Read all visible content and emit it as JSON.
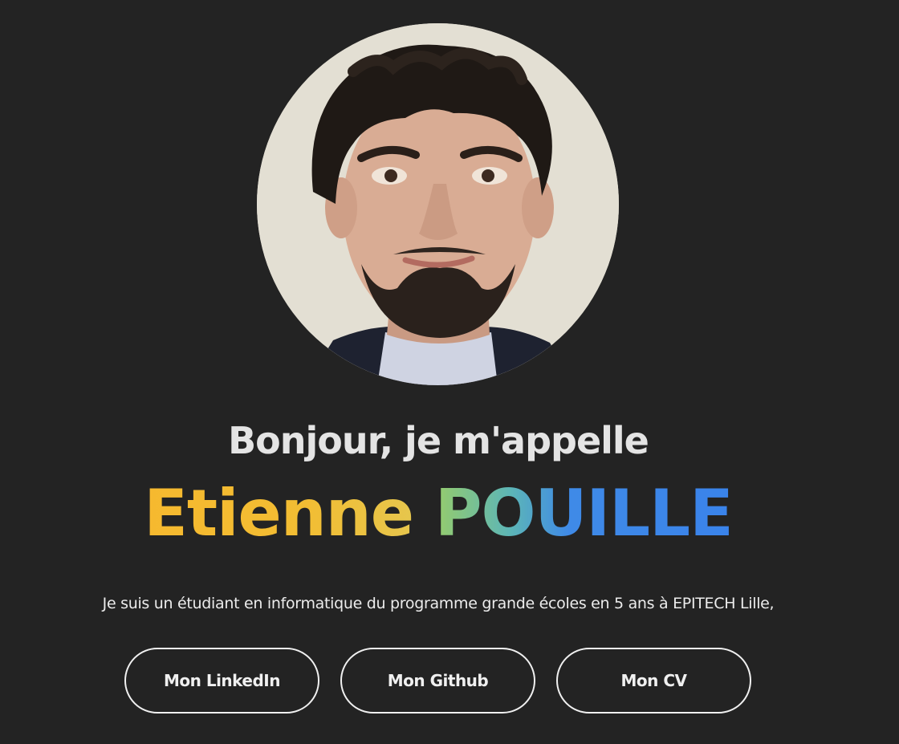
{
  "profile": {
    "photo_alt": "Photo de profil"
  },
  "hero": {
    "greeting": "Bonjour, je m'appelle",
    "first_name": "Etienne",
    "last_name": "POUILLE",
    "bio": "Je suis un étudiant en informatique du programme grande écoles en 5 ans à EPITECH Lille,"
  },
  "buttons": {
    "linkedin": "Mon LinkedIn",
    "github": "Mon Github",
    "cv": "Mon CV"
  },
  "colors": {
    "background": "#232323",
    "first_name_gradient": [
      "#f6b92f",
      "#e6c64d"
    ],
    "last_name_gradient": [
      "#96cc6c",
      "#5db6b6",
      "#3f8ae7"
    ]
  }
}
